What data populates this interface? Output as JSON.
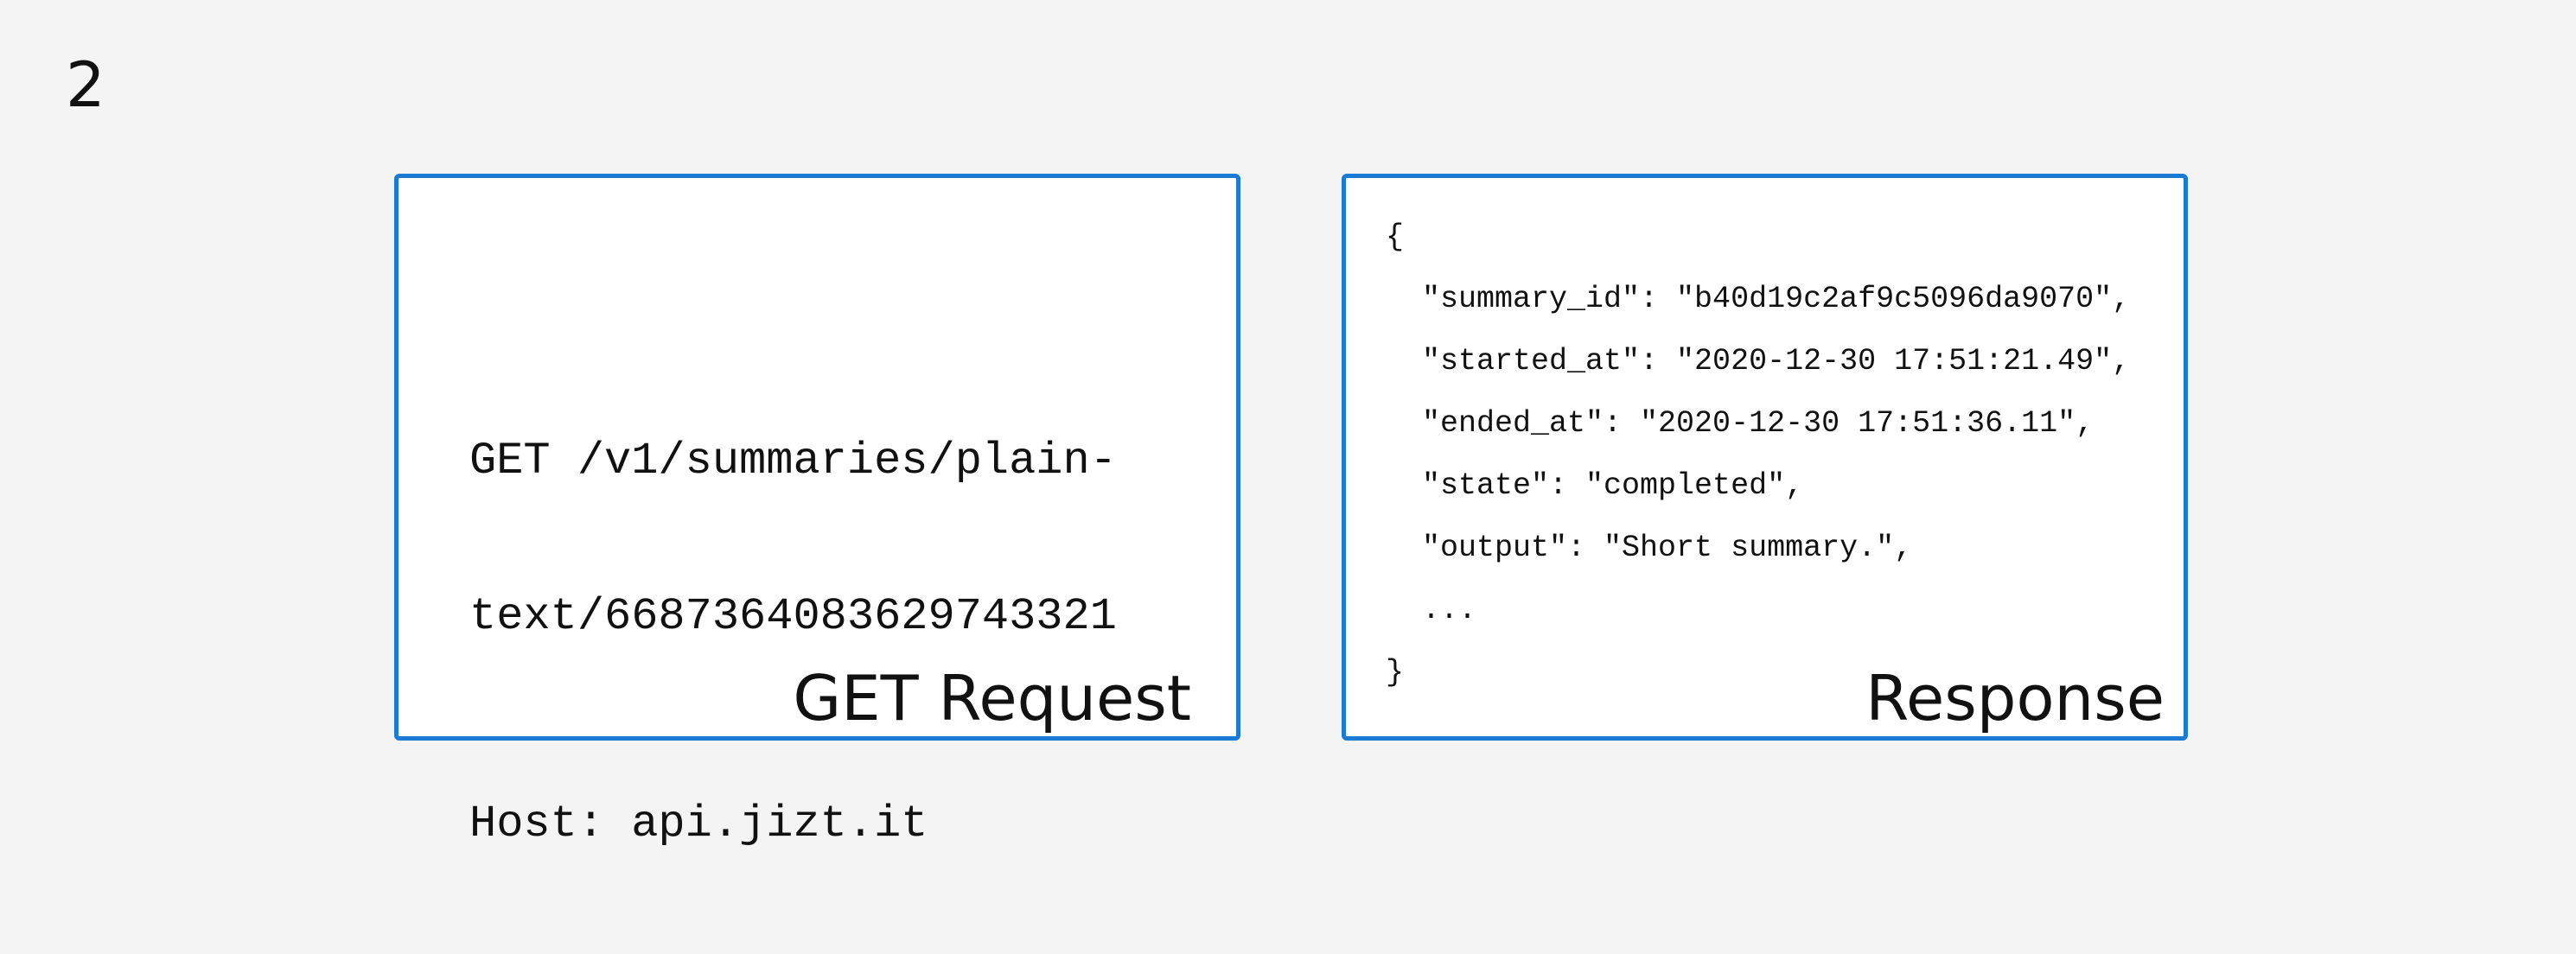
{
  "step_number": "2",
  "request_panel": {
    "lines": [
      "GET /v1/summaries/plain-",
      "text/6687364083629743321"
    ],
    "host": "Host: api.jizt.it",
    "caption": "GET Request"
  },
  "response_panel": {
    "lines": [
      "{",
      "  \"summary_id\": \"b40d19c2af9c5096da9070\",",
      "  \"started_at\": \"2020-12-30 17:51:21.49\",",
      "  \"ended_at\": \"2020-12-30 17:51:36.11\",",
      "  \"state\": \"completed\",",
      "  \"output\": \"Short summary.\",",
      "  ...",
      "}"
    ],
    "caption": "Response"
  },
  "colors": {
    "background": "#f4f4f4",
    "panel_border": "#1a7ad4",
    "panel_fill": "#ffffff",
    "text": "#111111"
  }
}
